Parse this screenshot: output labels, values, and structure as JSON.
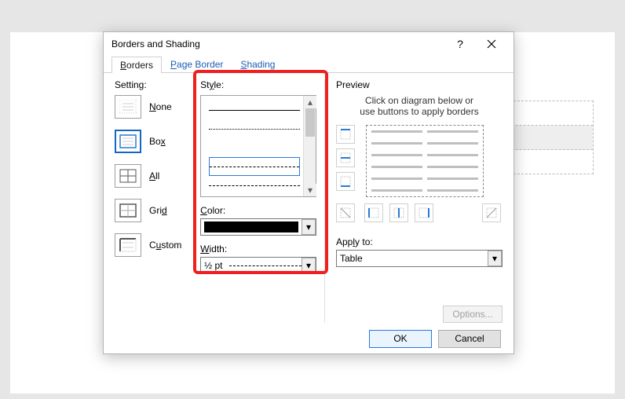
{
  "dialog": {
    "title": "Borders and Shading",
    "tabs": {
      "borders": "Borders",
      "page_border": "Page Border",
      "shading": "Shading",
      "active": "borders"
    }
  },
  "setting": {
    "heading": "Setting:",
    "items": [
      {
        "label": "None",
        "selected": false
      },
      {
        "label": "Box",
        "selected": true
      },
      {
        "label": "All",
        "selected": false
      },
      {
        "label": "Grid",
        "selected": false
      },
      {
        "label": "Custom",
        "selected": false
      }
    ]
  },
  "style": {
    "heading": "Style:",
    "color_label": "Color:",
    "color_value": "#000000",
    "width_label": "Width:",
    "width_value": "½ pt"
  },
  "preview": {
    "heading": "Preview",
    "hint_line1": "Click on diagram below or",
    "hint_line2": "use buttons to apply borders",
    "apply_label": "Apply to:",
    "apply_value": "Table",
    "options_label": "Options..."
  },
  "footer": {
    "ok": "OK",
    "cancel": "Cancel"
  }
}
